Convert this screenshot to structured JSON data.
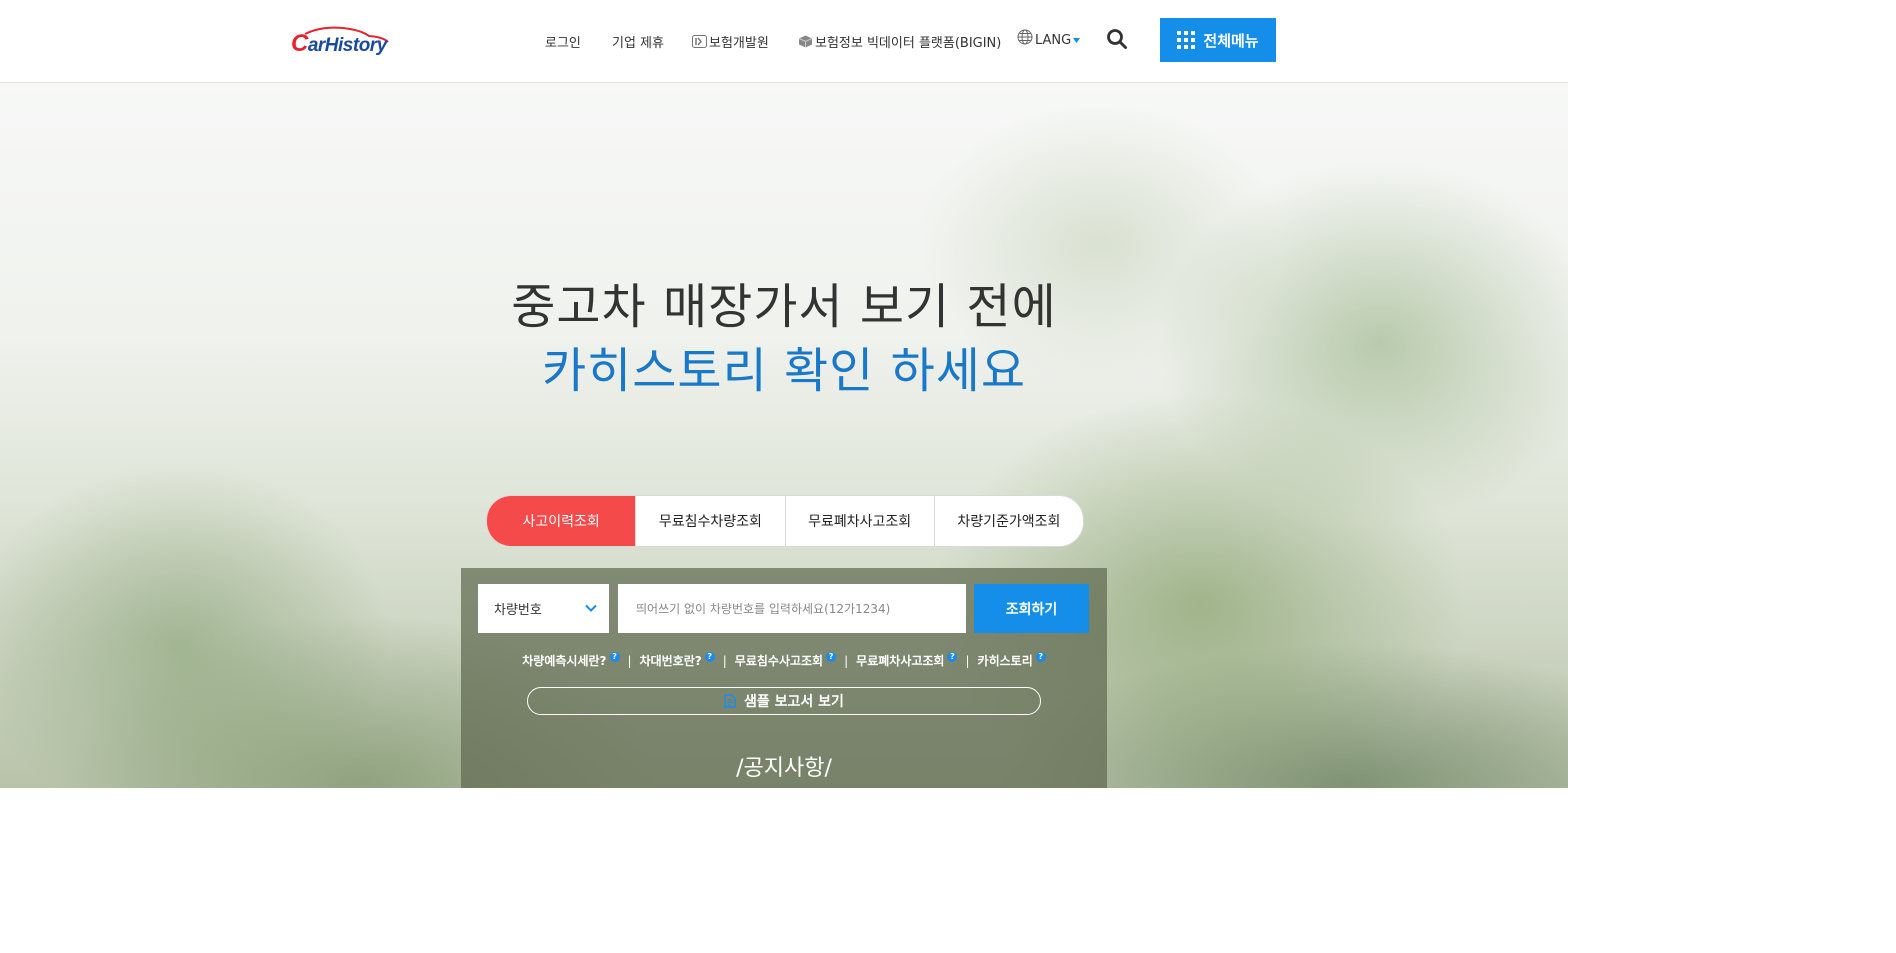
{
  "header": {
    "logo_text": "CarHistory",
    "nav": {
      "login": "로그인",
      "partnership": "기업 제휴",
      "kidi": "보험개발원",
      "bigin": "보험정보 빅데이터 플랫폼(BIGIN)",
      "lang": "LANG"
    },
    "menu_label": "전체메뉴",
    "colors": {
      "accent": "#148ee8",
      "logo_red": "#e8222d",
      "logo_blue": "#1a4aa0"
    }
  },
  "hero": {
    "headline_line1": "중고차 매장가서 보기 전에",
    "headline_line2": "카히스토리 확인 하세요",
    "colors": {
      "line2": "#1a78c8"
    }
  },
  "tabs": [
    {
      "label": "사고이력조회",
      "active": true
    },
    {
      "label": "무료침수차량조회",
      "active": false
    },
    {
      "label": "무료폐차사고조회",
      "active": false
    },
    {
      "label": "차량기준가액조회",
      "active": false
    }
  ],
  "search": {
    "select_value": "차량번호",
    "input_placeholder": "띄어쓰기 없이 차량번호를 입력하세요(12가1234)",
    "input_value": "",
    "submit_label": "조회하기"
  },
  "help_links": [
    {
      "label": "차량예측시세란?"
    },
    {
      "label": "차대번호란?"
    },
    {
      "label": "무료침수사고조회"
    },
    {
      "label": "무료폐차사고조회"
    },
    {
      "label": "카히스토리"
    }
  ],
  "help_separator": "|",
  "help_icon_glyph": "?",
  "sample_report_label": "샘플 보고서 보기",
  "notice_title": "/공지사항/",
  "colors": {
    "active_tab": "#f54a4a",
    "button_blue": "#148ee8"
  }
}
